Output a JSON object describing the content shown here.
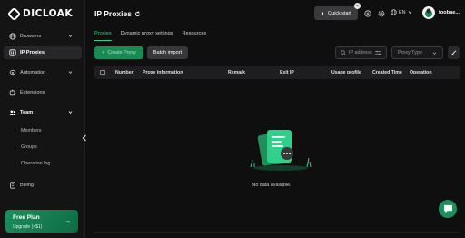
{
  "app": {
    "logo_text": "DICLOAK"
  },
  "sidebar": {
    "items": [
      {
        "label": "Browsers",
        "icon": "globe-icon",
        "has_chevron": true
      },
      {
        "label": "IP Proxies",
        "icon": "ip-icon",
        "active": true
      },
      {
        "label": "Automation",
        "icon": "automation-icon",
        "has_chevron": true
      },
      {
        "label": "Extensions",
        "icon": "puzzle-icon"
      },
      {
        "label": "Team",
        "icon": "team-icon",
        "has_chevron": true
      },
      {
        "label": "Members"
      },
      {
        "label": "Groups"
      },
      {
        "label": "Operation log"
      },
      {
        "label": "Billing",
        "icon": "billing-icon"
      }
    ],
    "free_plan": {
      "title": "Free Plan",
      "subtitle": "Upgrade (×$1)"
    }
  },
  "header": {
    "title": "IP Proxies",
    "quick_start_label": "Quick start",
    "language": "EN",
    "username": "toobae..."
  },
  "tabs": [
    {
      "label": "Proxies",
      "active": true
    },
    {
      "label": "Dynamic proxy settings"
    },
    {
      "label": "Resources"
    }
  ],
  "toolbar": {
    "create_label": "Create Proxy",
    "batch_import_label": "Batch import",
    "search_placeholder": "IP address",
    "proxy_type_placeholder": "Proxy Type"
  },
  "table": {
    "columns": [
      "Number",
      "Proxy information",
      "Remark",
      "Exit IP",
      "Usage profile",
      "Created Time",
      "Operation"
    ],
    "empty_text": "No data available."
  },
  "colors": {
    "accent": "#2fd08a",
    "brand_green": "#1a8a55",
    "background": "#0f0f10"
  }
}
